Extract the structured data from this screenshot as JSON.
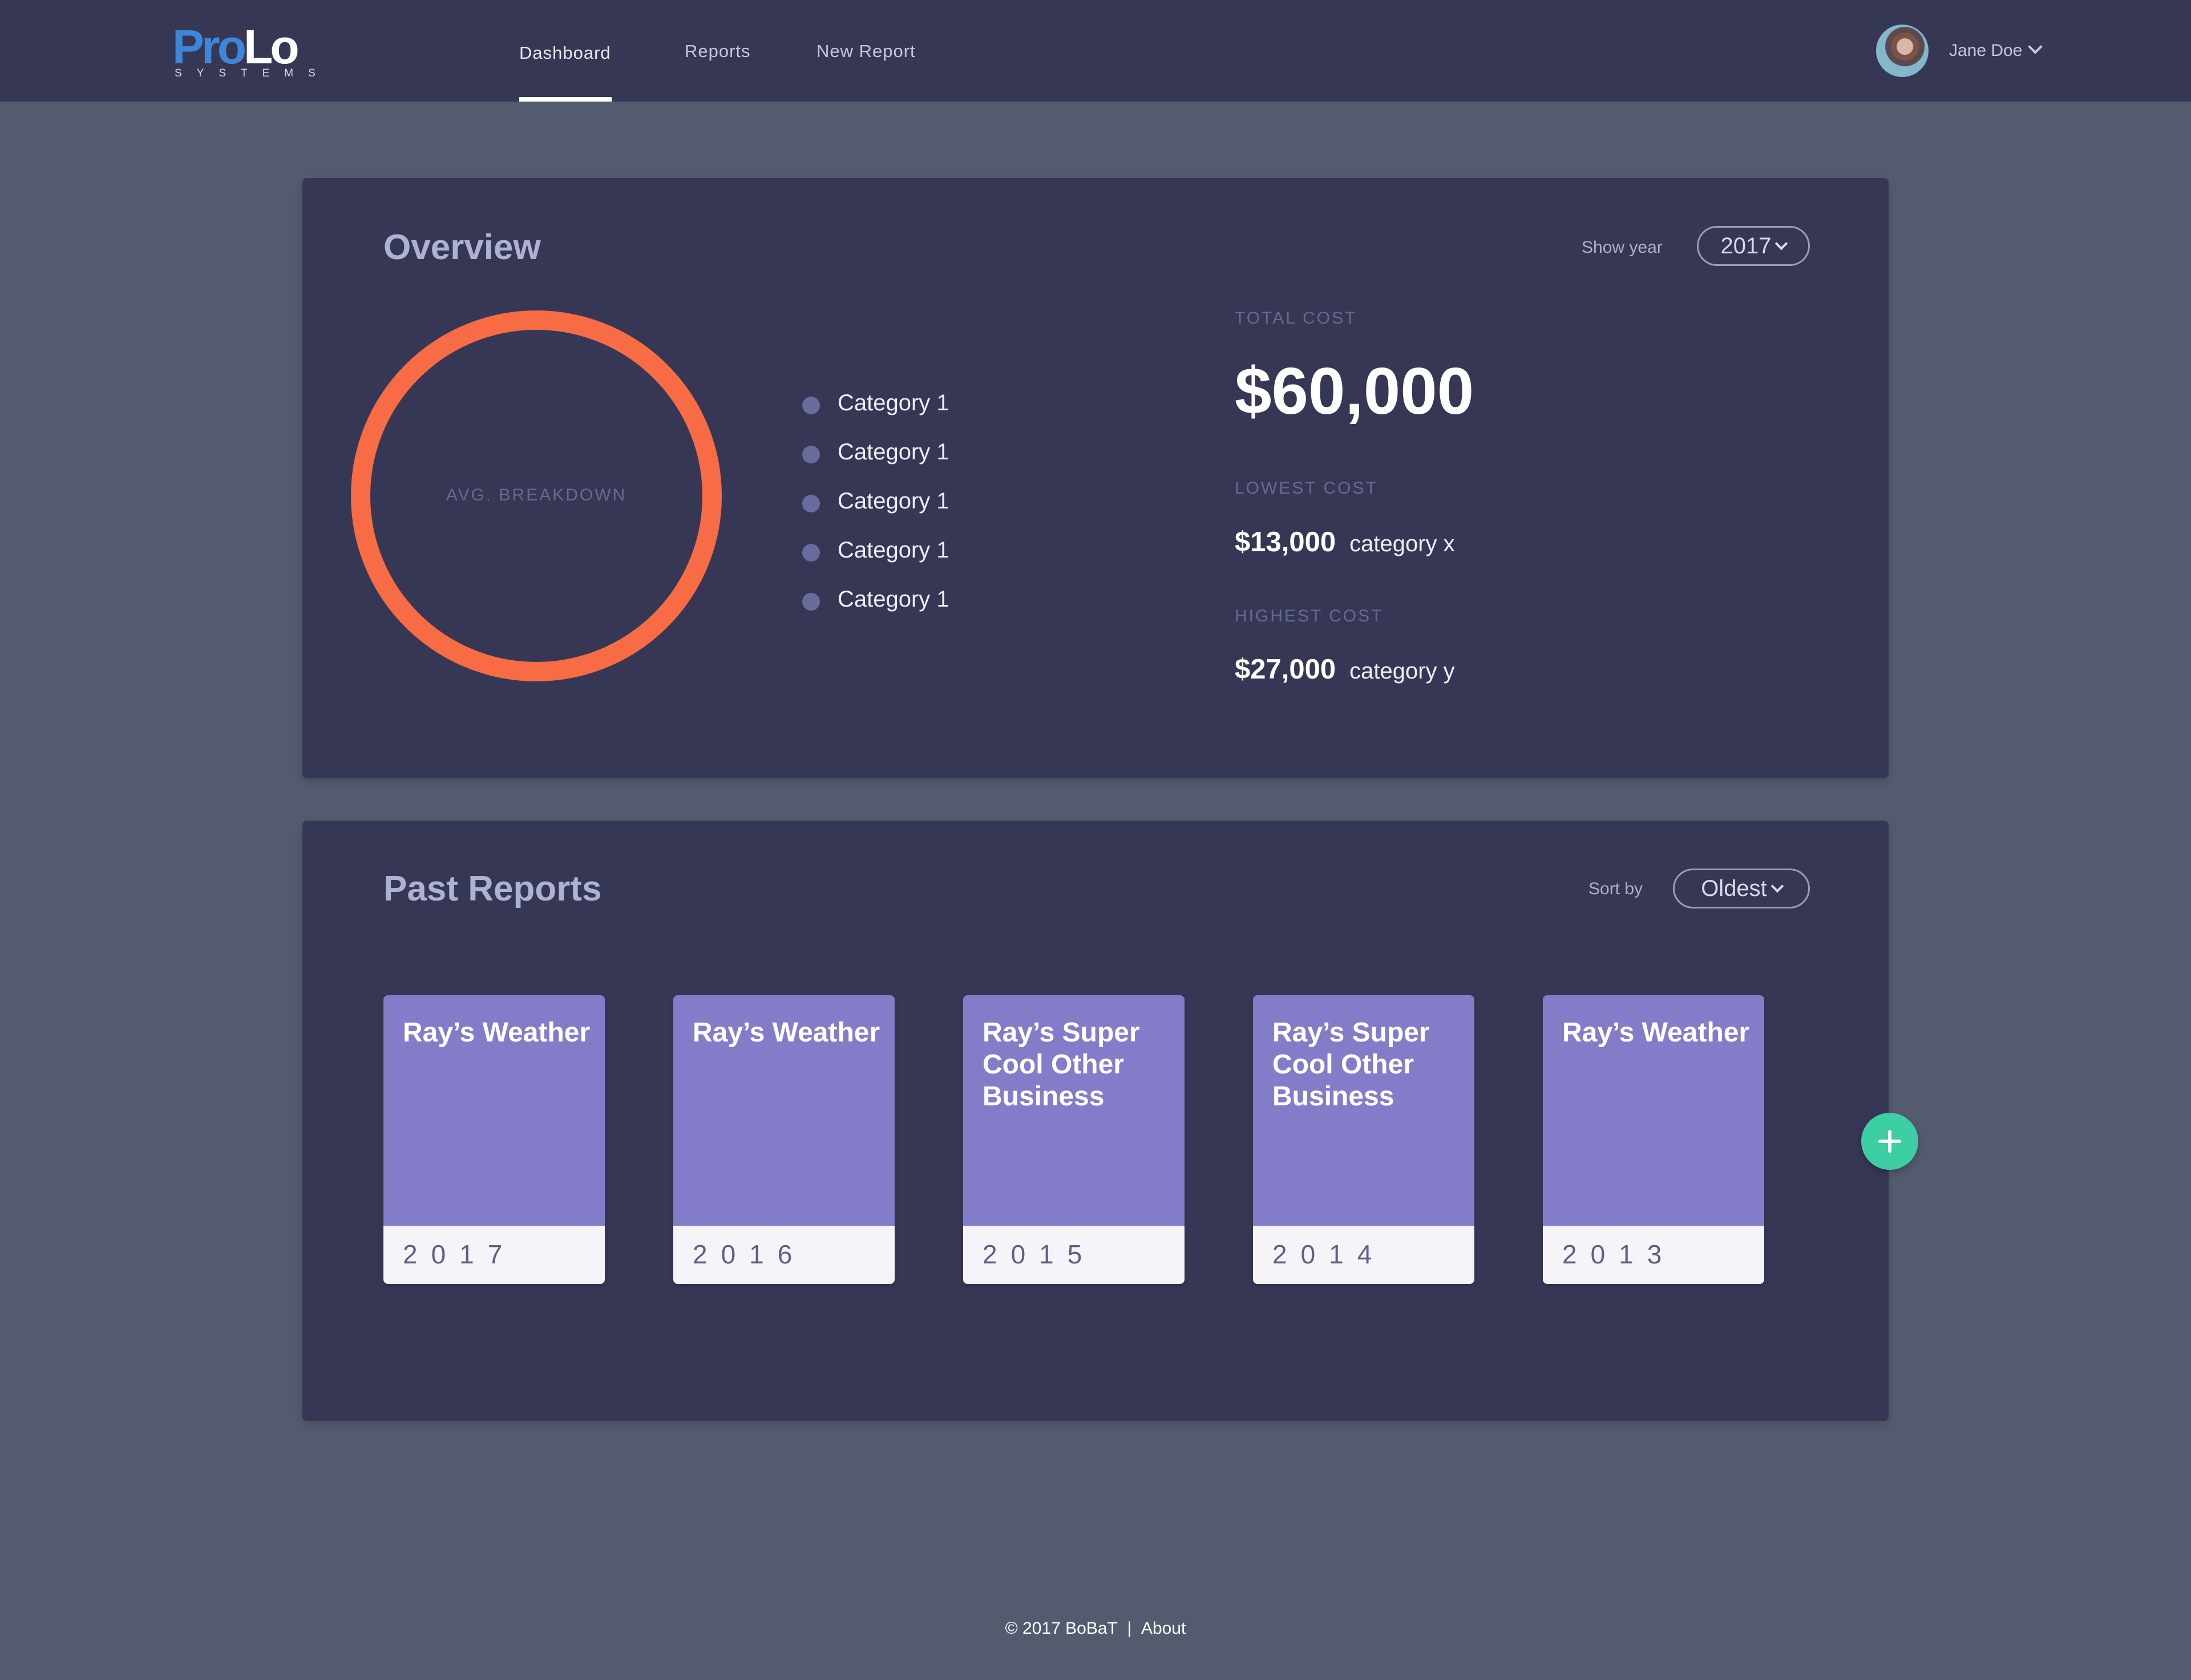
{
  "brand": {
    "logo_pro": "Pro",
    "logo_lo": "Lo",
    "logo_sub": "SYSTEMS",
    "pro_color": "#3d86d8"
  },
  "nav": {
    "items": [
      {
        "label": "Dashboard",
        "active": true
      },
      {
        "label": "Reports"
      },
      {
        "label": "New Report"
      }
    ]
  },
  "user": {
    "name": "Jane Doe"
  },
  "overview": {
    "title": "Overview",
    "show_year_label": "Show year",
    "year": "2017",
    "donut_label": "AVG. BREAKDOWN",
    "donut_color": "#f76b45",
    "legend": [
      "Category 1",
      "Category 1",
      "Category 1",
      "Category 1",
      "Category 1"
    ],
    "total_cost_label": "TOTAL COST",
    "total_cost": "$60,000",
    "lowest_cost_label": "LOWEST COST",
    "lowest_cost": "$13,000",
    "lowest_category": "category x",
    "highest_cost_label": "HIGHEST COST",
    "highest_cost": "$27,000",
    "highest_category": "category y"
  },
  "past_reports": {
    "title": "Past Reports",
    "sort_label": "Sort by",
    "sort_value": "Oldest",
    "cards": [
      {
        "title": "Ray’s Weather",
        "year": "2017"
      },
      {
        "title": "Ray’s Weather",
        "year": "2016"
      },
      {
        "title": "Ray’s Super Cool Other Business",
        "year": "2015"
      },
      {
        "title": "Ray’s Super Cool Other Business",
        "year": "2014"
      },
      {
        "title": "Ray’s Weather",
        "year": "2013"
      }
    ],
    "card_color": "#837dc9",
    "add_button_color": "#3ecea4"
  },
  "footer": {
    "copyright": "© 2017 BoBaT",
    "separator": "|",
    "about": "About"
  }
}
